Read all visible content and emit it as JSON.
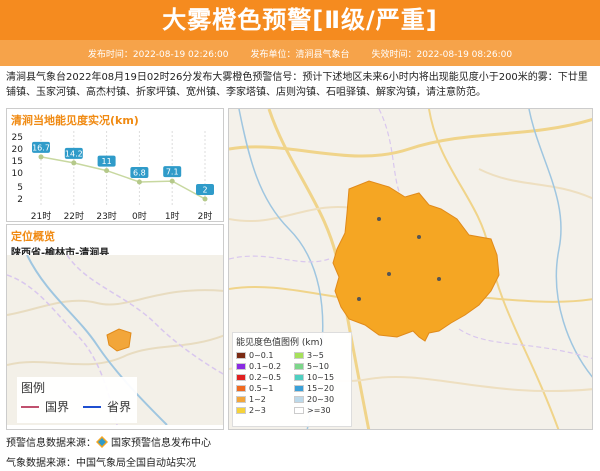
{
  "header": {
    "title": "大雾橙色预警[Ⅱ级/严重]"
  },
  "meta": {
    "issue_time": "发布时间：2022-08-19 02:26:00",
    "issuer": "发布单位：清涧县气象台",
    "expire_time": "失效时间：2022-08-19 08:26:00"
  },
  "description": "清涧县气象台2022年08月19日02时26分发布大雾橙色预警信号：预计下述地区未来6小时内将出现能见度小于200米的雾：下廿里铺镇、玉家河镇、高杰村镇、折家坪镇、宽州镇、李家塔镇、店则沟镇、石咀驿镇、解家沟镇，请注意防范。",
  "visibility_panel": {
    "title": "清涧当地能见度实况(km)"
  },
  "chart_data": {
    "type": "line",
    "categories": [
      "21时",
      "22时",
      "23时",
      "0时",
      "1时",
      "2时"
    ],
    "values": [
      16.7,
      14.2,
      11,
      6.8,
      7.1,
      2
    ],
    "y_ticks": [
      "25",
      "20",
      "15",
      "10",
      "5",
      "2"
    ],
    "colors": {
      "line": "#c8d8a0",
      "label_bg": "#2f9bc9",
      "point": "#2f9bc9"
    }
  },
  "location": {
    "title": "定位概览",
    "region": "陕西省-榆林市-清涧县",
    "legend_title": "图例",
    "legend_items": [
      {
        "label": "国界",
        "color": "#c0506e"
      },
      {
        "label": "省界",
        "color": "#1f4fd0"
      }
    ]
  },
  "visibility_legend": {
    "title": "能见度色值图例 (km)",
    "items": [
      {
        "label": "0~0.1",
        "color": "#7a2a12"
      },
      {
        "label": "3~5",
        "color": "#a6e05a"
      },
      {
        "label": "0.1~0.2",
        "color": "#8a2be2"
      },
      {
        "label": "5~10",
        "color": "#7dd68a"
      },
      {
        "label": "0.2~0.5",
        "color": "#e02020"
      },
      {
        "label": "10~15",
        "color": "#4fcfc0"
      },
      {
        "label": "0.5~1",
        "color": "#f06a1f"
      },
      {
        "label": "15~20",
        "color": "#3aa0d8"
      },
      {
        "label": "1~2",
        "color": "#f2a63a"
      },
      {
        "label": "20~30",
        "color": "#bcd9ea"
      },
      {
        "label": "2~3",
        "color": "#f5d23a"
      },
      {
        "label": ">=30",
        "color": "#ffffff"
      }
    ]
  },
  "footer": {
    "warning_source_label": "预警信息数据来源：",
    "warning_source_name": "国家预警信息发布中心",
    "weather_source": "气象数据来源：中国气象局全国自动站实况"
  }
}
